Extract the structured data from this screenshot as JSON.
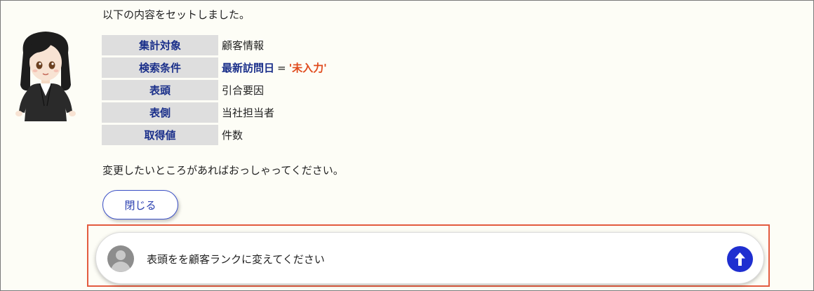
{
  "assistant": {
    "avatar_icon": "business-woman-avatar-icon",
    "intro": "以下の内容をセットしました。",
    "rows": [
      {
        "key": "集計対象",
        "value": "顧客情報"
      },
      {
        "key": "検索条件",
        "field": "最新訪問日",
        "operator": "=",
        "value": "'未入力'"
      },
      {
        "key": "表頭",
        "value": "引合要因"
      },
      {
        "key": "表側",
        "value": "当社担当者"
      },
      {
        "key": "取得値",
        "value": "件数"
      }
    ],
    "outro": "変更したいところがあればおっしゃってください。",
    "close_label": "閉じる"
  },
  "chat_input": {
    "user_icon": "user-avatar-icon",
    "value": "表頭をを顧客ランクに変えてください",
    "send_icon": "arrow-up-icon"
  },
  "colors": {
    "key_text": "#1a2f8a",
    "key_bg": "#dedede",
    "condition_value": "#e04a1c",
    "highlight_border": "#e35b3f",
    "send_button": "#1f2fd0"
  }
}
